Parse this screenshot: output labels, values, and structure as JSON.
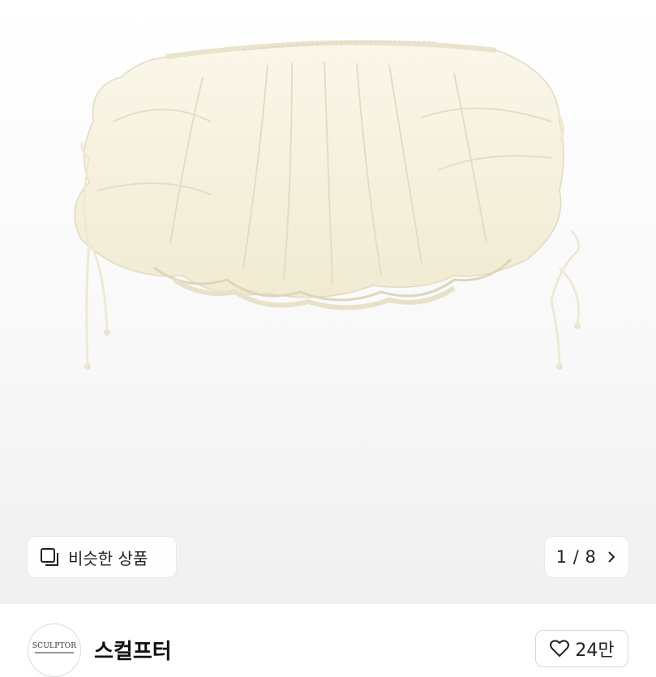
{
  "gallery": {
    "image_alt": "cream ruffled bubble skirt",
    "similar_button": {
      "label": "비슷한 상품",
      "icon": "similar-items-icon"
    },
    "pager": {
      "text": "1 / 8",
      "icon": "chevron-right-icon"
    }
  },
  "shop": {
    "avatar_text": "SCULPTOR",
    "name": "스컬프터",
    "likes": {
      "count": "24만",
      "icon": "heart-outline-icon"
    }
  },
  "colors": {
    "gallery_bg": "#f2f2f2",
    "skirt": "#f7f3e4",
    "skirt_shadow": "#e6dfc6"
  }
}
